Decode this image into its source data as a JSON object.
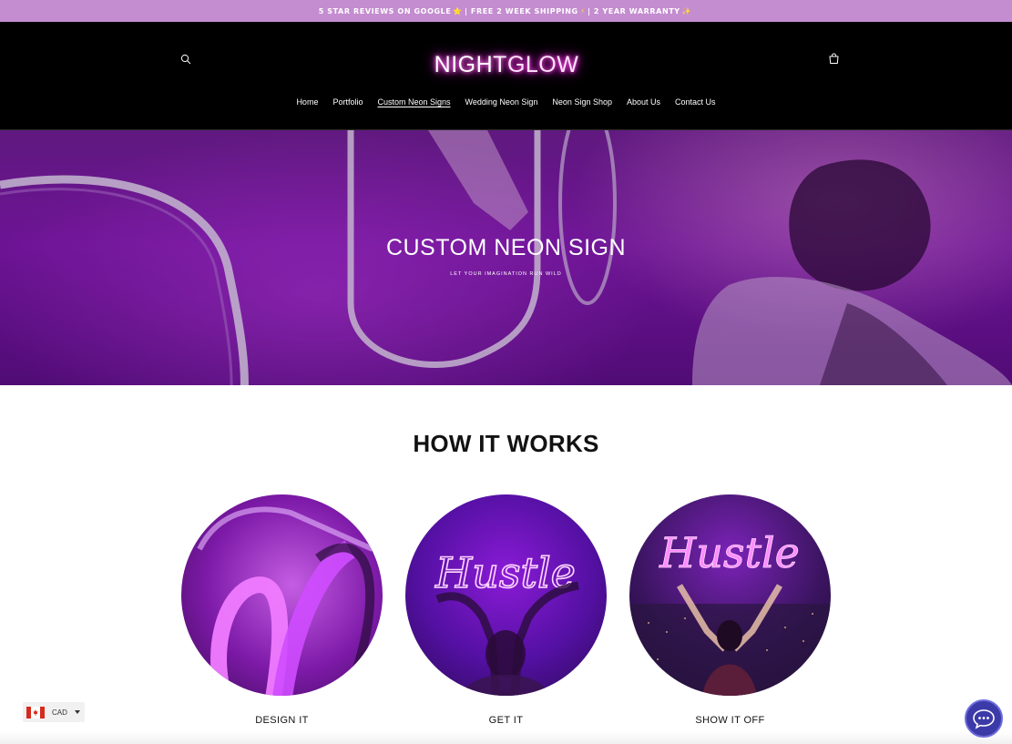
{
  "announcement": {
    "part1": "5 STAR REVIEWS ON GOOGLE",
    "star_glyph": "⭐",
    "part2": "| FREE 2 WEEK SHIPPING",
    "bolt_glyph": "⚡",
    "part3": "| 2 YEAR WARRANTY",
    "sparkle_glyph": "✨"
  },
  "header": {
    "logo_part1": "NIGHT",
    "logo_part2": "GLOW",
    "search_icon": "search-icon",
    "cart_icon": "cart-icon",
    "logo_glow_color": "#ff3ee0"
  },
  "nav": {
    "items": [
      {
        "label": "Home"
      },
      {
        "label": "Portfolio"
      },
      {
        "label": "Custom Neon Signs",
        "active": true
      },
      {
        "label": "Wedding Neon Sign"
      },
      {
        "label": "Neon Sign Shop"
      },
      {
        "label": "About Us"
      },
      {
        "label": "Contact Us"
      }
    ]
  },
  "hero": {
    "title": "CUSTOM NEON SIGN",
    "subtitle": "LET YOUR IMAGINATION RUN WILD"
  },
  "how_it_works": {
    "title": "HOW IT WORKS",
    "steps": [
      {
        "label": "DESIGN IT"
      },
      {
        "label": "GET IT",
        "neon_text": "Hustle"
      },
      {
        "label": "SHOW IT OFF",
        "neon_text": "Hustle"
      }
    ]
  },
  "currency": {
    "code": "CAD",
    "flag": "canada-flag-icon"
  },
  "chat": {
    "icon": "chat-bubble-icon"
  },
  "colors": {
    "announcement_bg": "#c48dd0",
    "header_bg": "#000000",
    "neon_pink": "#ff3ee0",
    "chat_bg": "#3b3aa8"
  }
}
